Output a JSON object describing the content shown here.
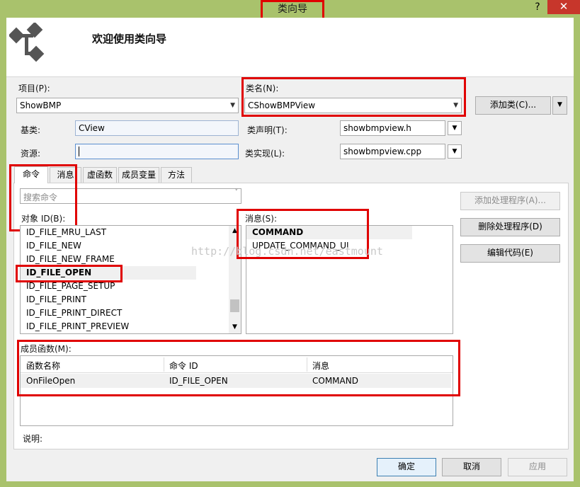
{
  "window": {
    "title": "类向导",
    "help": "?",
    "close": "✕"
  },
  "header": {
    "welcome": "欢迎使用类向导"
  },
  "project": {
    "label": "项目(P):",
    "value": "ShowBMP"
  },
  "classname": {
    "label": "类名(N):",
    "value": "CShowBMPView"
  },
  "add_class": {
    "label": "添加类(C)...",
    "arrow": "▼"
  },
  "base": {
    "label": "基类:",
    "value": "CView"
  },
  "resource": {
    "label": "资源:",
    "value": ""
  },
  "class_decl": {
    "label": "类声明(T):",
    "value": "showbmpview.h"
  },
  "class_impl": {
    "label": "类实现(L):",
    "value": "showbmpview.cpp"
  },
  "tabs": [
    "命令",
    "消息",
    "虚函数",
    "成员变量",
    "方法"
  ],
  "search": {
    "placeholder": "搜索命令"
  },
  "objects": {
    "label": "对象 ID(B):",
    "items": [
      "ID_FILE_MRU_LAST",
      "ID_FILE_NEW",
      "ID_FILE_NEW_FRAME",
      "ID_FILE_OPEN",
      "ID_FILE_PAGE_SETUP",
      "ID_FILE_PRINT",
      "ID_FILE_PRINT_DIRECT",
      "ID_FILE_PRINT_PREVIEW"
    ],
    "selected": "ID_FILE_OPEN"
  },
  "messages": {
    "label": "消息(S):",
    "items": [
      "COMMAND",
      "UPDATE_COMMAND_UI"
    ],
    "selected": "COMMAND"
  },
  "watermark": "http://blog.csdn.net/eastmount",
  "actions": {
    "add_handler": "添加处理程序(A)...",
    "delete_handler": "删除处理程序(D)",
    "edit_code": "编辑代码(E)"
  },
  "members": {
    "label": "成员函数(M):",
    "columns": [
      "函数名称",
      "命令 ID",
      "消息"
    ],
    "rows": [
      [
        "OnFileOpen",
        "ID_FILE_OPEN",
        "COMMAND"
      ]
    ]
  },
  "description": {
    "label": "说明:"
  },
  "footer": {
    "ok": "确定",
    "cancel": "取消",
    "apply": "应用"
  },
  "colors": {
    "frame": "#a9c26c",
    "close": "#c7362b",
    "highlight": "#e00000",
    "selection": "#f0f0f0"
  },
  "icons": [
    "class-wizard-icon",
    "help-icon",
    "close-icon",
    "dropdown-arrow-icon",
    "scroll-up-icon",
    "scroll-down-icon",
    "search-icon"
  ]
}
